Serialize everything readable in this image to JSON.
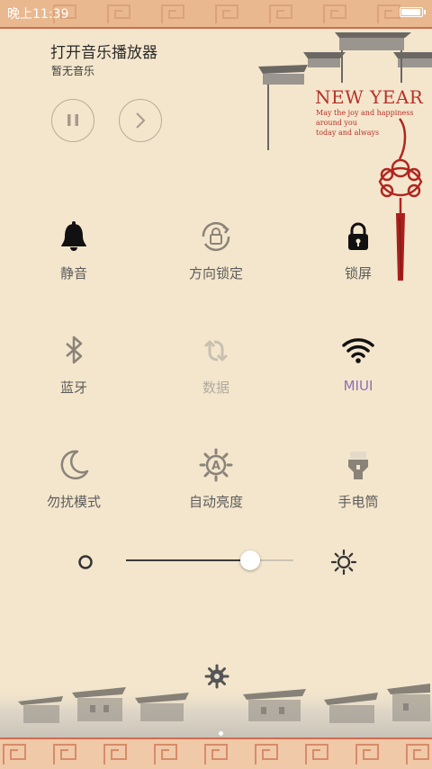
{
  "status_bar": {
    "time": "晚上11:39",
    "battery_level": 0.95
  },
  "music": {
    "title": "打开音乐播放器",
    "subtitle": "暂无音乐",
    "pause_icon": "pause-icon",
    "next_icon": "chevron-right-icon"
  },
  "banner": {
    "title": "NEW YEAR",
    "lines": [
      "May the joy and happiness",
      "around you",
      "today and always"
    ]
  },
  "toggles": [
    {
      "label": "静音",
      "icon": "bell-icon",
      "state": "on"
    },
    {
      "label": "方向锁定",
      "icon": "rotation-lock-icon",
      "state": "off"
    },
    {
      "label": "锁屏",
      "icon": "lock-icon",
      "state": "on"
    },
    {
      "label": "蓝牙",
      "icon": "bluetooth-icon",
      "state": "off"
    },
    {
      "label": "数据",
      "icon": "data-icon",
      "state": "disabled"
    },
    {
      "label": "MIUI",
      "icon": "wifi-icon",
      "state": "active"
    },
    {
      "label": "勿扰模式",
      "icon": "moon-icon",
      "state": "off"
    },
    {
      "label": "自动亮度",
      "icon": "auto-brightness-icon",
      "state": "off"
    },
    {
      "label": "手电筒",
      "icon": "flashlight-icon",
      "state": "off"
    }
  ],
  "brightness": {
    "level": 0.74,
    "low_icon": "brightness-low-icon",
    "high_icon": "brightness-high-icon"
  },
  "settings_icon": "gear-icon",
  "colors": {
    "background": "#f4e6cc",
    "accent_active": "#8c6fb4",
    "banner_red": "#b7322a"
  }
}
